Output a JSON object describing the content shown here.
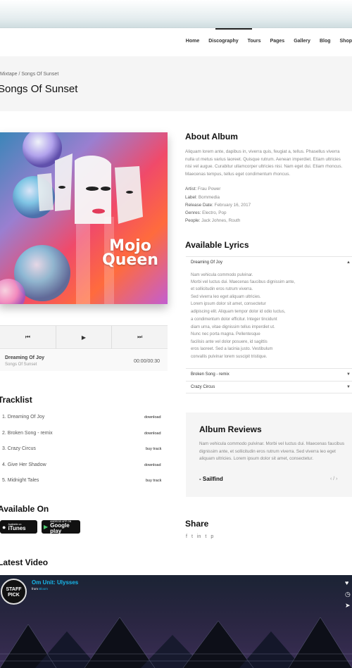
{
  "nav": {
    "items": [
      "Home",
      "Discography",
      "Tours",
      "Pages",
      "Gallery",
      "Blog",
      "Shop"
    ],
    "active": "Discography"
  },
  "breadcrumb": "Mixtape / Songs Of Sunset",
  "page_title": "Songs Of Sunset",
  "cover": {
    "title_line1": "Mojo",
    "title_line2": "Queen"
  },
  "player": {
    "prev_icon": "⏮",
    "play_icon": "▶",
    "next_icon": "⏭",
    "now_playing_title": "Dreaming Of Joy",
    "now_playing_album": "Songs Of Sunset",
    "time": "00:00/00:30"
  },
  "about": {
    "heading": "About Album",
    "text_lines": [
      "Aliquam lorem ante, dapibus in, viverra quis, feugiat a, tellus. Phasellus viverra",
      "nulla ut metus varius laoreet. Quisque rutrum. Aenean imperdiet. Etiam ultricies",
      "nisi vel augue. Curabitur ullamcorper ultricies nisi. Nam eget dui. Etiam rhoncus.",
      "Maecenas tempus, tellus eget condimentum rhoncus."
    ],
    "meta": [
      {
        "label": "Artist:",
        "value": "Frau Power"
      },
      {
        "label": "Label:",
        "value": "Bommedia"
      },
      {
        "label": "Release Date:",
        "value": "February 16, 2017"
      },
      {
        "label": "Genres:",
        "value": "Electro, Pop"
      },
      {
        "label": "People:",
        "value": "Jack Johnes, Routh"
      }
    ]
  },
  "lyrics": {
    "heading": "Available Lyrics",
    "open_song": "Dreaming Of Joy",
    "lines": [
      "Nam vehicula commodo pulvinar.",
      "Morbi vel luctus dui. Maecenas faucibus dignissim ante,",
      "et sollicitudin eros rutrum viverra.",
      "Sed viverra leo eget aliquam ultricies.",
      "Lorem ipsum dolor sit amet, consectetur",
      "adipiscing elit. Aliquam tempor dolor id odio luctus,",
      "a condimentum dolor efficitur. Integer tincidunt",
      "diam urna, vitae dignissim tellus imperdiet ut.",
      "Nunc nec porta magna. Pellentesque",
      "facilisis ante vel dolor posuere, id sagittis",
      "eros laoreet. Sed a lacinia justo. Vestibulum",
      "convallis pulvinar lorem suscipit tristique."
    ],
    "collapsed": [
      "Broken Song - remix",
      "Crazy Circus"
    ]
  },
  "tracklist": {
    "heading": "Tracklist",
    "tracks": [
      {
        "name": "1. Dreaming Of Joy",
        "action": "download"
      },
      {
        "name": "2. Broken Song - remix",
        "action": "download"
      },
      {
        "name": "3. Crazy Circus",
        "action": "buy track"
      },
      {
        "name": "4. Give Her Shadow",
        "action": "download"
      },
      {
        "name": "5. Midnight Tales",
        "action": "buy track"
      }
    ]
  },
  "reviews": {
    "heading": "Album Reviews",
    "text": "Nam vehicula commodo pulvinar. Morbi vel luctus dui. Maecenas faucibus dignissim ante, et sollicitudin eros rutrum viverra. Sed viverra leo eget aliquam ultricies. Lorem ipsum dolor sit amet, consectetur.",
    "author": "- Sailfind",
    "nav": "‹ / ›"
  },
  "available_on": {
    "heading": "Available On",
    "itunes_small": "Available on",
    "itunes_big": "iTunes",
    "google_small": "ANDROID APP ON",
    "google_big": "Google play"
  },
  "share": {
    "heading": "Share",
    "icons": [
      "f",
      "t",
      "in",
      "t",
      "p"
    ]
  },
  "latest_video": {
    "heading": "Latest Video",
    "title": "Om Unit: Ulysses",
    "from_prefix": "from",
    "from_name": "Bloom",
    "badge_line1": "STAFF",
    "badge_line2": "PICK"
  }
}
